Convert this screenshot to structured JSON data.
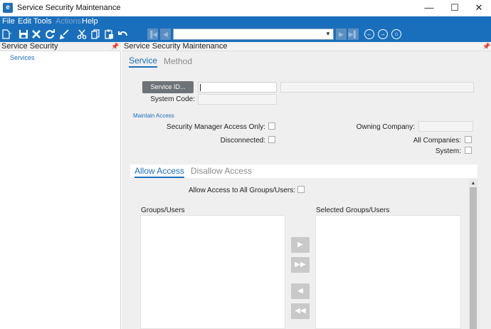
{
  "window": {
    "title": "Service Security Maintenance",
    "app_icon": "e",
    "controls": {
      "minimize": "—",
      "maximize": "☐",
      "close": "✕"
    }
  },
  "menu": {
    "items": [
      {
        "label": "File",
        "enabled": true
      },
      {
        "label": "Edit",
        "enabled": true
      },
      {
        "label": "Tools",
        "enabled": true
      },
      {
        "label": "Actions",
        "enabled": false
      },
      {
        "label": "Help",
        "enabled": true
      }
    ]
  },
  "toolbar": {
    "icons": [
      "new-icon",
      "save-icon",
      "delete-icon",
      "refresh-icon",
      "clear-icon",
      "cut-icon",
      "copy-icon",
      "paste-icon",
      "undo-icon",
      "first-icon",
      "previous-icon",
      "next-icon",
      "last-icon",
      "back-icon",
      "forward-icon",
      "home-icon"
    ],
    "nav_combo_value": ""
  },
  "tree": {
    "title": "Service Security",
    "items": [
      {
        "label": "Services"
      }
    ]
  },
  "main": {
    "title": "Service Security Maintenance",
    "tabs": [
      {
        "label": "Service",
        "active": true
      },
      {
        "label": "Method",
        "active": false
      }
    ],
    "service_id_button": "Service ID...",
    "service_id_value": "",
    "service_description": "",
    "system_code_label": "System Code:",
    "system_code_value": "",
    "maintain_access_label": "Maintain Access",
    "security_manager_label": "Security Manager Access Only:",
    "disconnected_label": "Disconnected:",
    "owning_company_label": "Owning Company:",
    "owning_company_value": "",
    "all_companies_label": "All Companies:",
    "system_label": "System:",
    "access_tabs": [
      {
        "label": "Allow Access",
        "active": true
      },
      {
        "label": "Disallow Access",
        "active": false
      }
    ],
    "allow_all_label": "Allow Access to All Groups/Users:",
    "groups_users_label": "Groups/Users",
    "selected_groups_label": "Selected Groups/Users",
    "move_buttons": [
      "▶",
      "▶▶",
      "◀",
      "◀◀"
    ]
  },
  "colors": {
    "brand": "#1a6fbc",
    "panel_bg": "#efefef",
    "button_dark": "#6e7378",
    "button_disabled": "#c9c9c9"
  }
}
